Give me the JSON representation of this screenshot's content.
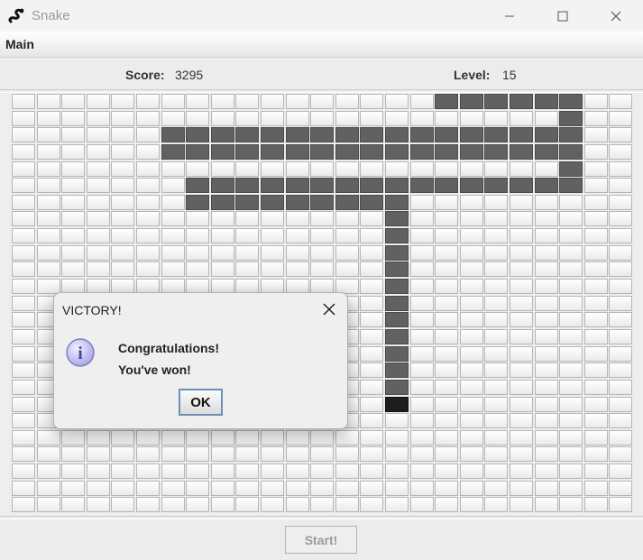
{
  "window": {
    "title": "Snake",
    "icons": {
      "app": "snake-logo-icon",
      "minimize": "minimize-icon",
      "maximize": "maximize-icon",
      "close": "close-icon"
    }
  },
  "menu": {
    "items": [
      "Main"
    ]
  },
  "stats": {
    "score_label": "Score:",
    "score_value": "3295",
    "level_label": "Level:",
    "level_value": "15"
  },
  "board": {
    "columns": 25,
    "rows": 25,
    "snake_color": "#616161",
    "head_color": "#1d1d1d",
    "snake_cells": [
      [
        0,
        17
      ],
      [
        0,
        18
      ],
      [
        0,
        19
      ],
      [
        0,
        20
      ],
      [
        0,
        21
      ],
      [
        0,
        22
      ],
      [
        1,
        22
      ],
      [
        2,
        6
      ],
      [
        2,
        7
      ],
      [
        2,
        8
      ],
      [
        2,
        9
      ],
      [
        2,
        10
      ],
      [
        2,
        11
      ],
      [
        2,
        12
      ],
      [
        2,
        13
      ],
      [
        2,
        14
      ],
      [
        2,
        15
      ],
      [
        2,
        16
      ],
      [
        2,
        17
      ],
      [
        2,
        18
      ],
      [
        2,
        19
      ],
      [
        2,
        20
      ],
      [
        2,
        21
      ],
      [
        2,
        22
      ],
      [
        3,
        6
      ],
      [
        3,
        7
      ],
      [
        3,
        8
      ],
      [
        3,
        9
      ],
      [
        3,
        10
      ],
      [
        3,
        11
      ],
      [
        3,
        12
      ],
      [
        3,
        13
      ],
      [
        3,
        14
      ],
      [
        3,
        15
      ],
      [
        3,
        16
      ],
      [
        3,
        17
      ],
      [
        3,
        18
      ],
      [
        3,
        19
      ],
      [
        3,
        20
      ],
      [
        3,
        21
      ],
      [
        3,
        22
      ],
      [
        4,
        22
      ],
      [
        5,
        7
      ],
      [
        5,
        8
      ],
      [
        5,
        9
      ],
      [
        5,
        10
      ],
      [
        5,
        11
      ],
      [
        5,
        12
      ],
      [
        5,
        13
      ],
      [
        5,
        14
      ],
      [
        5,
        15
      ],
      [
        5,
        16
      ],
      [
        5,
        17
      ],
      [
        5,
        18
      ],
      [
        5,
        19
      ],
      [
        5,
        20
      ],
      [
        5,
        21
      ],
      [
        5,
        22
      ],
      [
        6,
        7
      ],
      [
        6,
        8
      ],
      [
        6,
        9
      ],
      [
        6,
        10
      ],
      [
        6,
        11
      ],
      [
        6,
        12
      ],
      [
        6,
        13
      ],
      [
        6,
        14
      ],
      [
        6,
        15
      ],
      [
        7,
        15
      ],
      [
        8,
        15
      ],
      [
        9,
        15
      ],
      [
        10,
        15
      ],
      [
        11,
        15
      ],
      [
        12,
        15
      ],
      [
        13,
        15
      ],
      [
        14,
        15
      ],
      [
        15,
        15
      ],
      [
        16,
        15
      ],
      [
        17,
        15
      ]
    ],
    "head_cell": [
      18,
      15
    ]
  },
  "dialog": {
    "title": "VICTORY!",
    "icon": "info-icon",
    "line1": "Congratulations!",
    "line2": "You've won!",
    "ok_label": "OK",
    "close_icon": "close-icon"
  },
  "controls": {
    "start_label": "Start!"
  }
}
